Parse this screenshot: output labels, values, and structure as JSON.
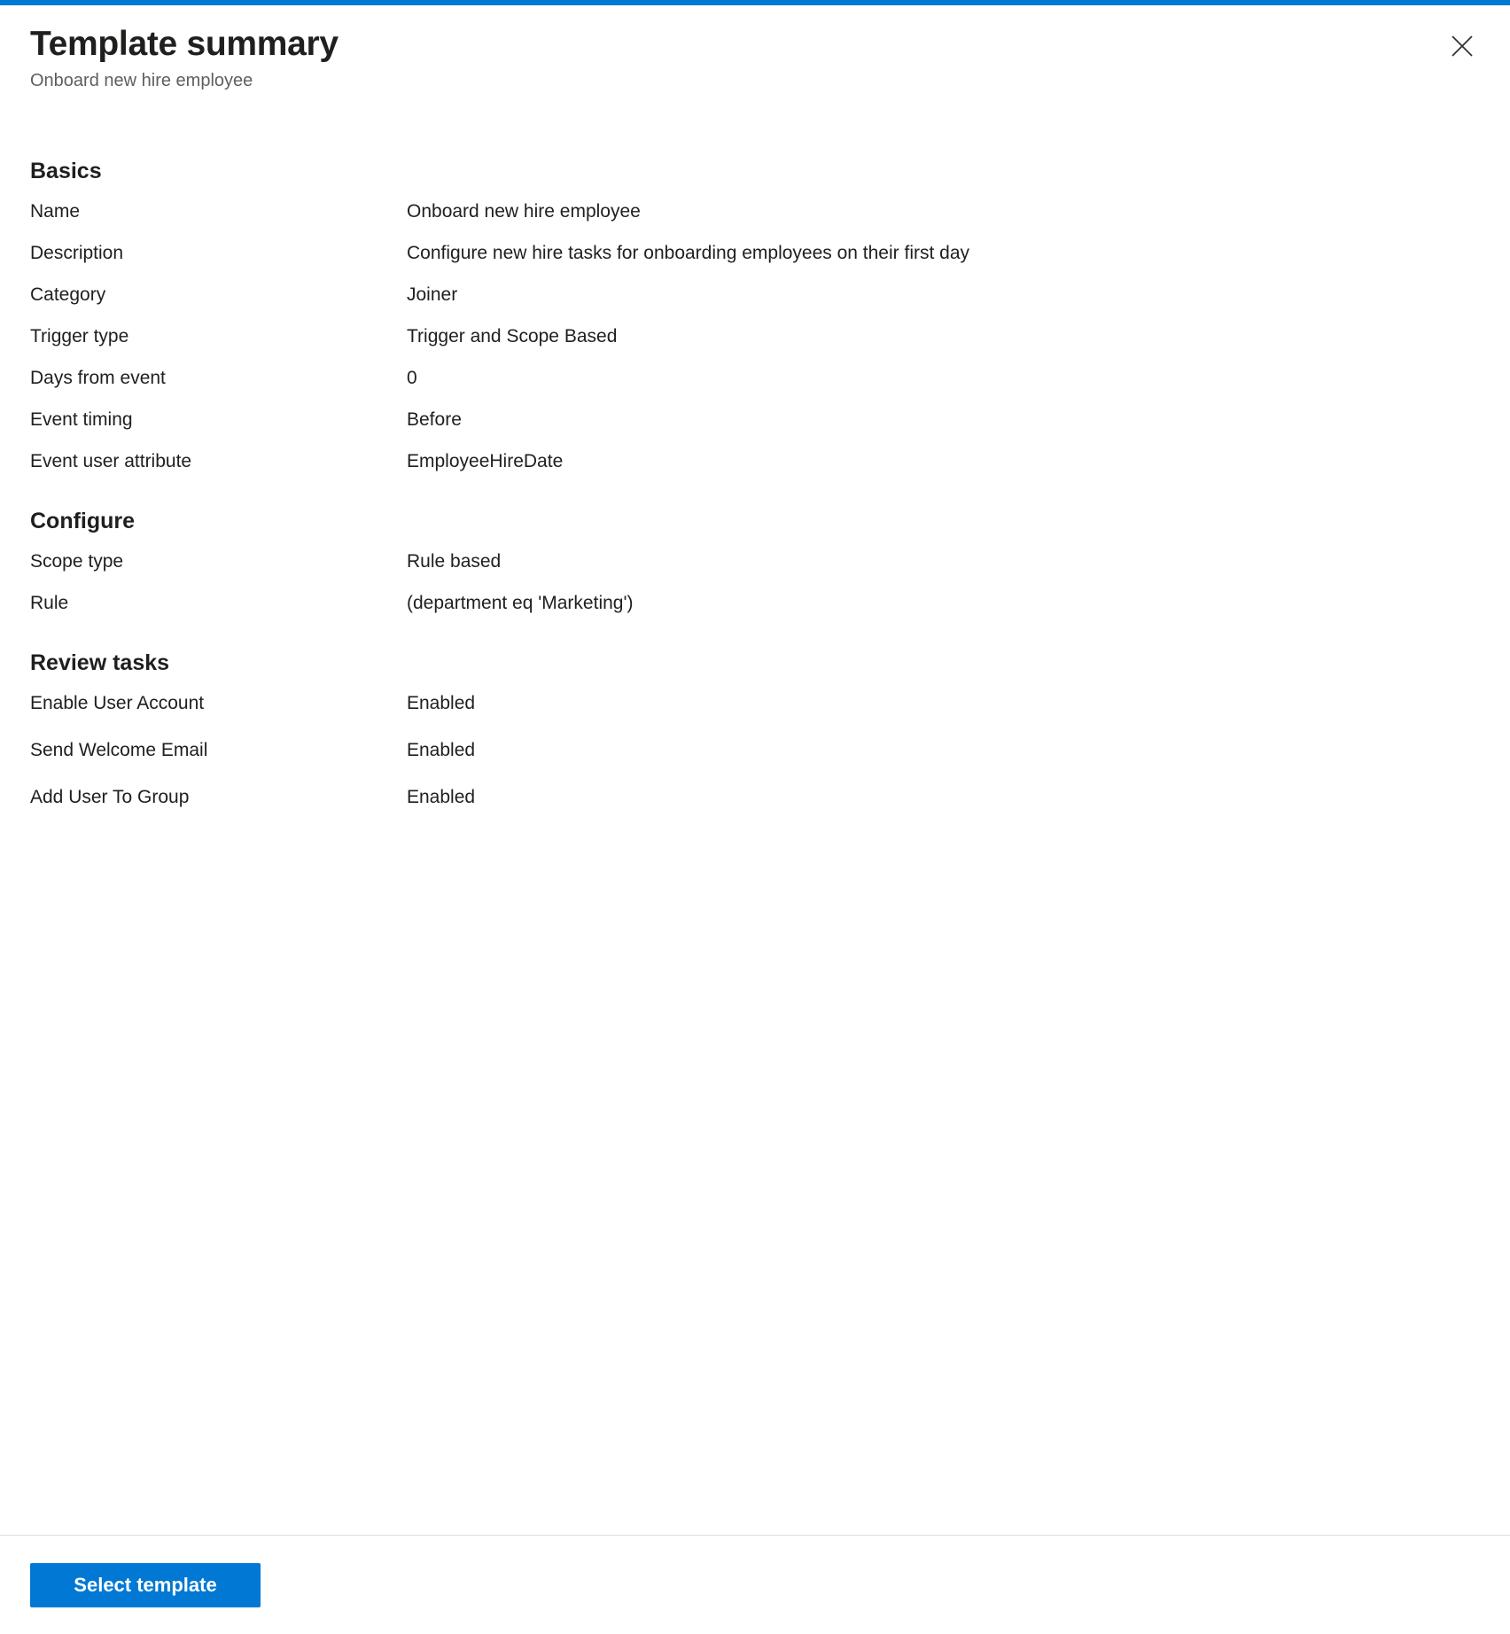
{
  "accent_color": "#0078d4",
  "header": {
    "title": "Template summary",
    "subtitle": "Onboard new hire employee",
    "close_icon": "close-icon"
  },
  "sections": [
    {
      "title": "Basics",
      "rows": [
        {
          "label": "Name",
          "value": "Onboard new hire employee"
        },
        {
          "label": "Description",
          "value": "Configure new hire tasks for onboarding employees on their first day"
        },
        {
          "label": "Category",
          "value": "Joiner"
        },
        {
          "label": "Trigger type",
          "value": "Trigger and Scope Based"
        },
        {
          "label": "Days from event",
          "value": "0"
        },
        {
          "label": "Event timing",
          "value": "Before"
        },
        {
          "label": "Event user attribute",
          "value": "EmployeeHireDate"
        }
      ]
    },
    {
      "title": "Configure",
      "rows": [
        {
          "label": "Scope type",
          "value": "Rule based"
        },
        {
          "label": "Rule",
          "value": "(department eq 'Marketing')"
        }
      ]
    },
    {
      "title": "Review tasks",
      "rows": [
        {
          "label": "Enable User Account",
          "value": "Enabled"
        },
        {
          "label": "Send Welcome Email",
          "value": "Enabled"
        },
        {
          "label": "Add User To Group",
          "value": "Enabled"
        }
      ]
    }
  ],
  "footer": {
    "primary_button_label": "Select template"
  }
}
